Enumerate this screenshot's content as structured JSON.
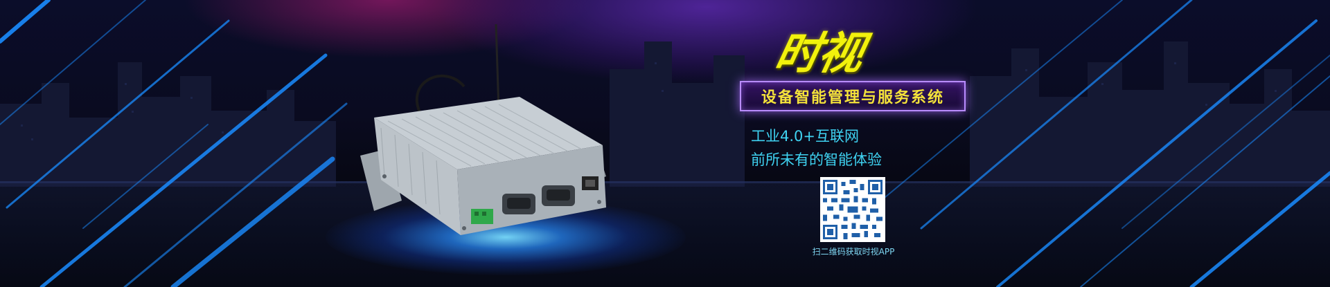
{
  "banner": {
    "logo_text": "时视",
    "subtitle": "设备智能管理与服务系统",
    "tagline_line1": "工业4.0+互联网",
    "tagline_line2": "前所未有的智能体验",
    "qr_caption": "扫二维码获取时视APP"
  },
  "colors": {
    "logo": "#f2f20c",
    "subtitle_text": "#f4e23a",
    "subtitle_border": "#b98cff",
    "tagline": "#3fd3f2",
    "streak_blue": "#1a8cff"
  },
  "icons": {
    "product": "iot-gateway-device-image",
    "qr": "qr-code-icon"
  }
}
